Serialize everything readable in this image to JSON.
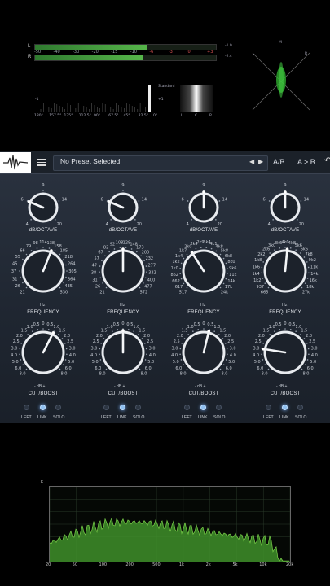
{
  "meter": {
    "top_scale": [
      "-50",
      "-40",
      "-30",
      "-20",
      "-15",
      "-10",
      "-6",
      "-3",
      "0",
      "+3"
    ],
    "channel_l": "L",
    "channel_r": "R",
    "peak_l": "-1.9",
    "peak_r": "-2.4",
    "level_l": 0.62,
    "level_r": 0.6,
    "corr_scale": [
      "-1",
      "0",
      "+1"
    ],
    "corr_side": "Standard",
    "phase_scale": [
      "180°",
      "157.5°",
      "135°",
      "112.5°",
      "90°",
      "67.5°",
      "45°",
      "22.5°",
      "0°"
    ],
    "lcr_labels": [
      "L",
      "C",
      "R"
    ],
    "scope_labels": {
      "m": "M",
      "l": "L",
      "r": "R"
    }
  },
  "plugin": {
    "preset": "No Preset Selected",
    "ab_compare": "A/B",
    "ab_copy": "A > B",
    "bands": [
      {
        "octave_label": "dB/OCTAVE",
        "octave_ticks": [
          "4",
          "6",
          "9",
          "14",
          "20"
        ],
        "octave_value": 0.25,
        "freq_ticks": [
          "21",
          "26",
          "31",
          "37",
          "45",
          "55",
          "66",
          "79",
          "98",
          "114",
          "138",
          "158",
          "185",
          "218",
          "264",
          "305",
          "364",
          "435",
          "530"
        ],
        "freq_value": 0.58,
        "freq_unit": "Hz",
        "freq_label": "FREQUENCY",
        "gain_ticks": [
          "8.0",
          "6.0",
          "5.0",
          "4.0",
          "3.0",
          "2.5",
          "2.0",
          "1.5",
          "1.0",
          "0.5",
          "0",
          "0.5",
          "1.0",
          "1.5",
          "2.0",
          "2.5",
          "3.0",
          "4.0",
          "5.0",
          "6.0",
          "8.0"
        ],
        "gain_value": 0.6,
        "gain_unit": "- dB +",
        "gain_label": "CUT/BOOST",
        "buttons": {
          "left": "LEFT",
          "link": "LINK",
          "solo": "SOLO"
        },
        "link_on": true
      },
      {
        "octave_label": "dB/OCTAVE",
        "octave_ticks": [
          "4",
          "6",
          "9",
          "14",
          "20"
        ],
        "octave_value": 0.25,
        "freq_ticks": [
          "21",
          "26",
          "31",
          "38",
          "47",
          "57",
          "67",
          "82",
          "92",
          "108",
          "128",
          "148",
          "173",
          "200",
          "232",
          "277",
          "332",
          "400",
          "477",
          "572"
        ],
        "freq_value": 0.5,
        "freq_unit": "Hz",
        "freq_label": "FREQUENCY",
        "gain_ticks": [
          "8.0",
          "6.0",
          "5.0",
          "4.0",
          "3.0",
          "2.5",
          "2.0",
          "1.5",
          "1.0",
          "0.5",
          "0",
          "0.5",
          "1.0",
          "1.5",
          "2.0",
          "2.5",
          "3.0",
          "4.0",
          "5.0",
          "6.0",
          "8.0"
        ],
        "gain_value": 0.5,
        "gain_unit": "- dB +",
        "gain_label": "CUT/BOOST",
        "buttons": {
          "left": "LEFT",
          "link": "LINK",
          "solo": "SOLO"
        },
        "link_on": true
      },
      {
        "octave_label": "dB/OCTAVE",
        "octave_ticks": [
          "4",
          "6",
          "9",
          "14",
          "20"
        ],
        "octave_value": 0.5,
        "freq_ticks": [
          "517",
          "617",
          "662",
          "862",
          "1k0",
          "1k2",
          "1k4",
          "1k7",
          "2k0",
          "2k4",
          "2k9",
          "3k4",
          "4k1",
          "4k8",
          "5k8",
          "6k8",
          "8k0",
          "9k6",
          "11k",
          "14k",
          "17k",
          "24k"
        ],
        "freq_value": 0.38,
        "freq_unit": "Hz",
        "freq_label": "FREQUENCY",
        "gain_ticks": [
          "8.0",
          "6.0",
          "5.0",
          "4.0",
          "3.0",
          "2.5",
          "2.0",
          "1.5",
          "1.0",
          "0.5",
          "0",
          "0.5",
          "1.0",
          "1.5",
          "2.0",
          "2.5",
          "3.0",
          "4.0",
          "5.0",
          "6.0",
          "8.0"
        ],
        "gain_value": 0.55,
        "gain_unit": "- dB +",
        "gain_label": "CUT/BOOST",
        "buttons": {
          "left": "LEFT",
          "link": "LINK",
          "solo": "SOLO"
        },
        "link_on": true
      },
      {
        "octave_label": "dB/OCTAVE",
        "octave_ticks": [
          "4",
          "6",
          "9",
          "14",
          "20"
        ],
        "octave_value": 0.5,
        "freq_ticks": [
          "665",
          "937",
          "1k2",
          "1k4",
          "1k6",
          "1k8",
          "2k2",
          "2k6",
          "3k0",
          "3k6",
          "4k0",
          "4k8",
          "5k6",
          "6k6",
          "7k8",
          "9k2",
          "11k",
          "14k",
          "16k",
          "18k",
          "27k"
        ],
        "freq_value": 0.52,
        "freq_unit": "Hz",
        "freq_label": "FREQUENCY",
        "gain_ticks": [
          "8.0",
          "6.0",
          "5.0",
          "4.0",
          "3.0",
          "2.5",
          "2.0",
          "1.5",
          "1.0",
          "0.5",
          "0",
          "0.5",
          "1.0",
          "1.5",
          "2.0",
          "2.5",
          "3.0",
          "4.0",
          "5.0",
          "6.0",
          "8.0"
        ],
        "gain_value": 0.2,
        "gain_unit": "- dB +",
        "gain_label": "CUT/BOOST",
        "buttons": {
          "left": "LEFT",
          "link": "LINK",
          "solo": "SOLO"
        },
        "link_on": true
      }
    ]
  },
  "analyzer": {
    "freq_labels": [
      "20",
      "50",
      "100",
      "200",
      "500",
      "1k",
      "2k",
      "5k",
      "10k",
      "20k"
    ],
    "colors": {
      "fill": "#3f8f2a",
      "edge": "#7ad04a",
      "grid": "#2a3a2a"
    }
  }
}
